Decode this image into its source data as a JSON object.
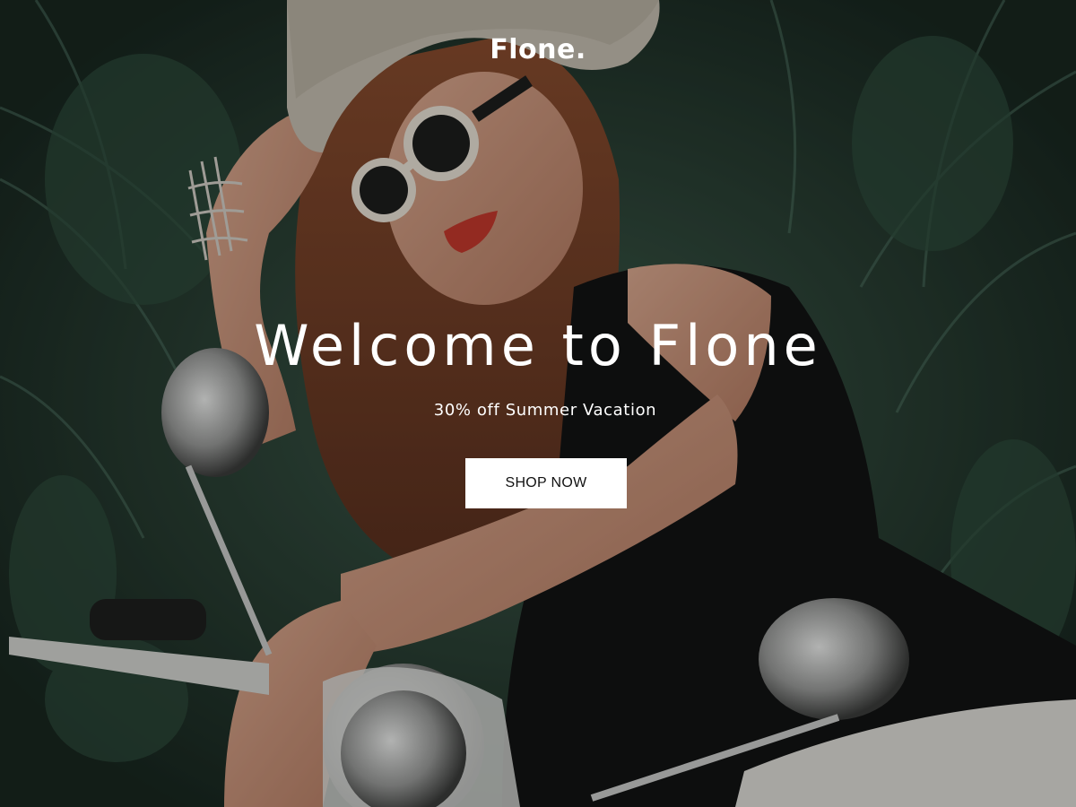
{
  "brand": {
    "logo_text": "Flone."
  },
  "hero": {
    "title": "Welcome to Flone",
    "subtitle": "30% off Summer Vacation",
    "cta_label": "SHOP NOW",
    "background_image": "woman-on-scooter-photo"
  },
  "colors": {
    "text": "#ffffff",
    "button_bg": "#ffffff",
    "button_text": "#111111",
    "foliage": "#22362c"
  }
}
